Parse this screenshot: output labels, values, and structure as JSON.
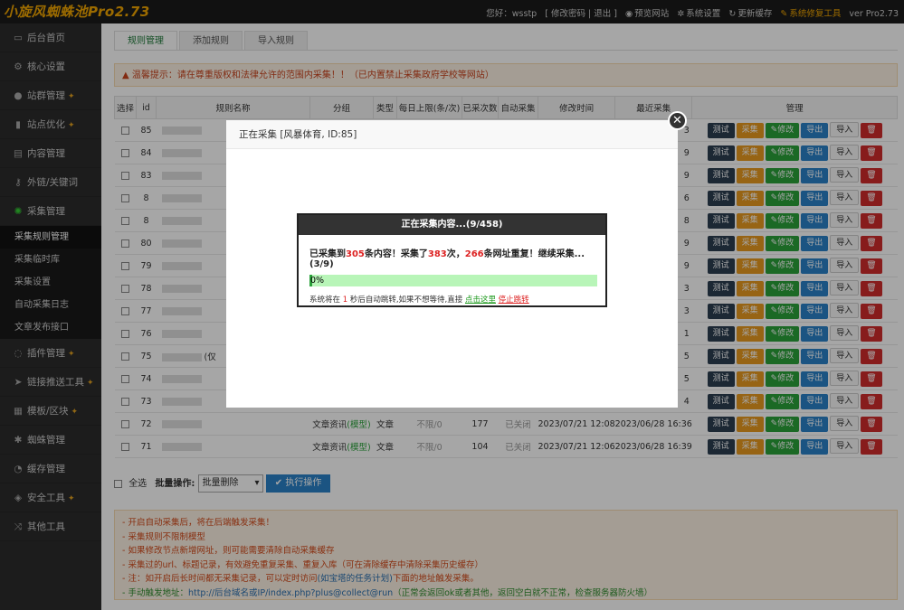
{
  "header": {
    "logo": "小旋风蜘蛛池Pro2.73",
    "greeting": "您好：wsstp",
    "account_links": "[ 修改密码 | 退出 ]",
    "preview": "预览网站",
    "settings": "系统设置",
    "update_cache": "更新缓存",
    "repair": "系统修复工具",
    "version": "ver Pro2.73"
  },
  "sidebar": {
    "items": [
      {
        "label": "后台首页",
        "icon": "monitor-icon"
      },
      {
        "label": "核心设置",
        "icon": "gear-icon"
      },
      {
        "label": "站群管理",
        "icon": "user-icon",
        "pin": "📌"
      },
      {
        "label": "站点优化",
        "icon": "chart-icon",
        "pin": "📌"
      },
      {
        "label": "内容管理",
        "icon": "file-icon"
      },
      {
        "label": "外链/关键词",
        "icon": "key-icon"
      },
      {
        "label": "采集管理",
        "icon": "spider-icon"
      }
    ],
    "sub_items": [
      "采集规则管理",
      "采集临时库",
      "采集设置",
      "自动采集日志",
      "文章发布接口"
    ],
    "items2": [
      {
        "label": "插件管理",
        "icon": "bulb-icon",
        "pin": "📌"
      },
      {
        "label": "链接推送工具",
        "icon": "send-icon",
        "pin": "📌"
      },
      {
        "label": "模板/区块",
        "icon": "grid-icon",
        "pin": "📌"
      },
      {
        "label": "蜘蛛管理",
        "icon": "bug-icon"
      },
      {
        "label": "缓存管理",
        "icon": "cache-icon"
      },
      {
        "label": "安全工具",
        "icon": "shield-icon",
        "pin": "📌"
      },
      {
        "label": "其他工具",
        "icon": "random-icon"
      }
    ]
  },
  "tabs": [
    "规则管理",
    "添加规则",
    "导入规则"
  ],
  "notice": "温馨提示：请在尊重版权和法律允许的范围内采集！！（已内置禁止采集政府学校等网站）",
  "table": {
    "headers": [
      "选择",
      "id",
      "规则名称",
      "分组",
      "类型",
      "每日上限(条/次)",
      "已采次数",
      "自动采集",
      "修改时间",
      "最近采集",
      "管理"
    ],
    "rows": [
      {
        "id": "85",
        "tail": "3"
      },
      {
        "id": "84",
        "tail": "9"
      },
      {
        "id": "83",
        "tail": "9"
      },
      {
        "id": "8",
        "tail": "6"
      },
      {
        "id": "8",
        "tail": "8"
      },
      {
        "id": "80",
        "tail": "9"
      },
      {
        "id": "79",
        "tail": "9"
      },
      {
        "id": "78",
        "tail": "3"
      },
      {
        "id": "77",
        "tail": "3"
      },
      {
        "id": "76",
        "tail": "1"
      },
      {
        "id": "75",
        "tail": "5"
      },
      {
        "id": "74",
        "tail": "5"
      },
      {
        "id": "73",
        "tail": "4"
      },
      {
        "id": "72",
        "group": "文章资讯",
        "group_tag": "(模型)",
        "type": "文章",
        "limit": "不限/0",
        "count": "177",
        "auto": "已关闭",
        "modified": "2023/07/21 12:08",
        "last": "2023/06/28 16:36"
      },
      {
        "id": "71",
        "group": "文章资讯",
        "group_tag": "(模型)",
        "type": "文章",
        "limit": "不限/0",
        "count": "104",
        "auto": "已关闭",
        "modified": "2023/07/21 12:06",
        "last": "2023/06/28 16:39"
      }
    ],
    "buttons": {
      "test": "测试",
      "collect": "采集",
      "edit": "修改",
      "export": "导出",
      "import": "导入",
      "delete": "🗑"
    },
    "partial_75": "(仅"
  },
  "bulk": {
    "select_all": "全选",
    "label": "批量操作:",
    "option": "批量删除",
    "execute": "执行操作"
  },
  "tips": [
    "- 开启自动采集后，将在后端触发采集！",
    "- 采集规则不限制模型",
    "- 如果修改节点新增网址，则可能需要清除自动采集缓存",
    "- 采集过的url、标题记录，有效避免重复采集、重复入库（可在清除缓存中清除采集历史缓存）",
    "- 注：如开启后长时间都无采集记录，可以定时访问",
    "(如宝塔的任务计划)",
    "下面的地址触发采集。",
    "- 手动触发地址：",
    "http://后台域名或IP/index.php?plus@collect@run",
    "（正常会返回ok或者其他，返回空白就不正常，检查服务器防火墙）"
  ],
  "modal": {
    "title": "正在采集 [风暴体育, ID:85]",
    "close": "✕",
    "inner_title": "正在采集内容...(9/458)",
    "msg_a": "已采集到",
    "msg_b": "305",
    "msg_c": "条内容！采集了",
    "msg_d": "383",
    "msg_e": "次，",
    "msg_f": "266",
    "msg_g": "条网址重复！继续采集...(3/9)",
    "progress_text": "0%",
    "progress": 0.01,
    "note_a": "系统将在",
    "note_num": "1",
    "note_b": "秒后自动跳转,如果不想等待,直接",
    "note_link": "点击这里",
    "note_stop": "停止跳转"
  }
}
